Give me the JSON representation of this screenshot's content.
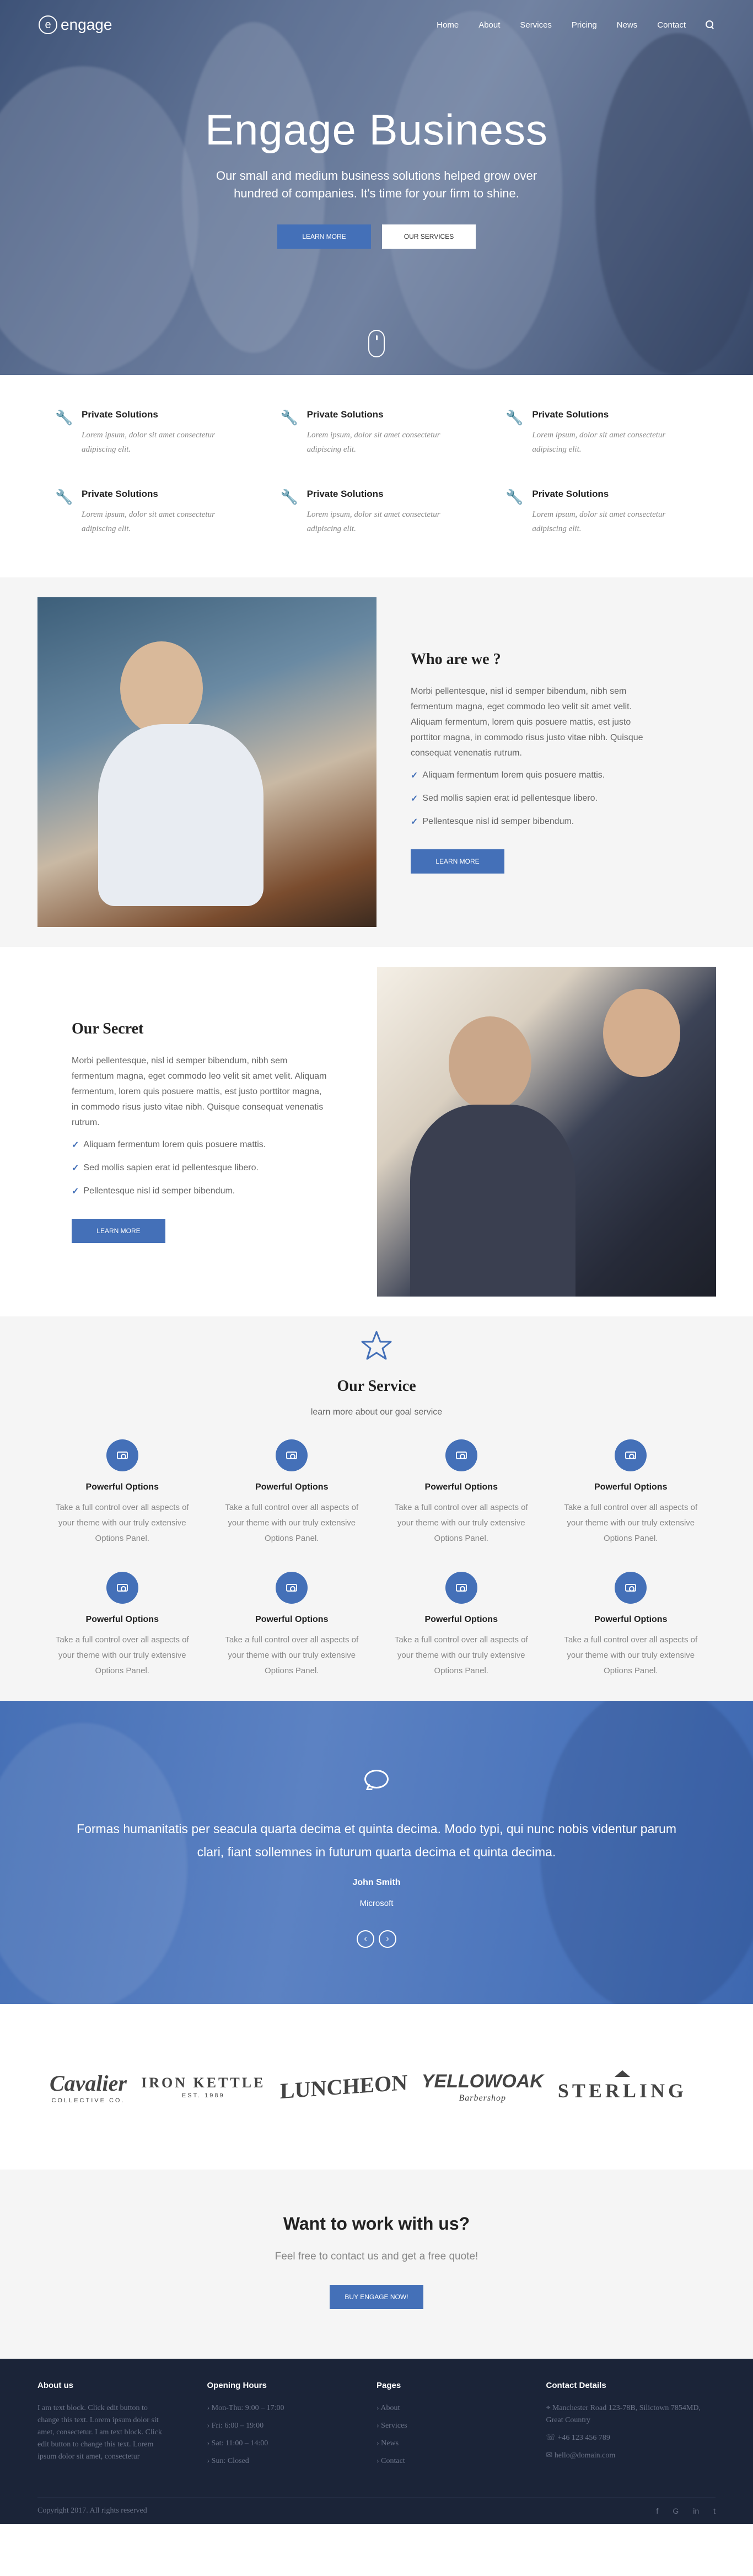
{
  "nav": {
    "logo": "engage",
    "items": [
      {
        "label": "Home",
        "icon": "caret-down-icon"
      },
      {
        "label": "About"
      },
      {
        "label": "Services",
        "icon": "caret-down-icon"
      },
      {
        "label": "Pricing"
      },
      {
        "label": "News"
      },
      {
        "label": "Contact"
      }
    ],
    "search_icon": "search-icon"
  },
  "hero": {
    "title": "Engage Business",
    "subtitle": "Our small and medium business solutions helped grow over hundred of companies. It's time for your firm to shine.",
    "btn_primary": "LEARN MORE",
    "btn_secondary": "OUR SERVICES"
  },
  "features": [
    {
      "icon": "wrench-icon",
      "title": "Private Solutions",
      "text": "Lorem ipsum, dolor sit amet consectetur adipiscing elit."
    },
    {
      "icon": "wrench-icon",
      "title": "Private Solutions",
      "text": "Lorem ipsum, dolor sit amet consectetur adipiscing elit."
    },
    {
      "icon": "wrench-icon",
      "title": "Private Solutions",
      "text": "Lorem ipsum, dolor sit amet consectetur adipiscing elit."
    },
    {
      "icon": "wrench-icon",
      "title": "Private Solutions",
      "text": "Lorem ipsum, dolor sit amet consectetur adipiscing elit."
    },
    {
      "icon": "wrench-icon",
      "title": "Private Solutions",
      "text": "Lorem ipsum, dolor sit amet consectetur adipiscing elit."
    },
    {
      "icon": "wrench-icon",
      "title": "Private Solutions",
      "text": "Lorem ipsum, dolor sit amet consectetur adipiscing elit."
    }
  ],
  "about": {
    "title": "Who are we ?",
    "text": "Morbi pellentesque, nisl id semper bibendum, nibh sem fermentum magna, eget commodo leo velit sit amet velit. Aliquam fermentum, lorem quis posuere mattis, est justo porttitor magna, in commodo risus justo vitae nibh. Quisque consequat venenatis rutrum.",
    "checks": [
      "Aliquam fermentum lorem quis posuere mattis.",
      "Sed mollis sapien erat id pellentesque libero.",
      "Pellentesque nisl id semper bibendum."
    ],
    "button": "LEARN MORE"
  },
  "secret": {
    "title": "Our Secret",
    "text": "Morbi pellentesque, nisl id semper bibendum, nibh sem fermentum magna, eget commodo leo velit sit amet velit. Aliquam fermentum, lorem quis posuere mattis, est justo porttitor magna, in commodo risus justo vitae nibh. Quisque consequat venenatis rutrum.",
    "checks": [
      "Aliquam fermentum lorem quis posuere mattis.",
      "Sed mollis sapien erat id pellentesque libero.",
      "Pellentesque nisl id semper bibendum."
    ],
    "button": "LEARN MORE"
  },
  "service": {
    "title": "Our Service",
    "subtitle": "learn more about our goal service",
    "items": [
      {
        "title": "Powerful Options",
        "text": "Take a full control over all aspects of your theme with our truly extensive Options Panel."
      },
      {
        "title": "Powerful Options",
        "text": "Take a full control over all aspects of your theme with our truly extensive Options Panel."
      },
      {
        "title": "Powerful Options",
        "text": "Take a full control over all aspects of your theme with our truly extensive Options Panel."
      },
      {
        "title": "Powerful Options",
        "text": "Take a full control over all aspects of your theme with our truly extensive Options Panel."
      },
      {
        "title": "Powerful Options",
        "text": "Take a full control over all aspects of your theme with our truly extensive Options Panel."
      },
      {
        "title": "Powerful Options",
        "text": "Take a full control over all aspects of your theme with our truly extensive Options Panel."
      },
      {
        "title": "Powerful Options",
        "text": "Take a full control over all aspects of your theme with our truly extensive Options Panel."
      },
      {
        "title": "Powerful Options",
        "text": "Take a full control over all aspects of your theme with our truly extensive Options Panel."
      }
    ]
  },
  "testimonial": {
    "quote": "Formas humanitatis per seacula quarta decima et quinta decima. Modo typi, qui nunc nobis videntur parum clari, fiant sollemnes in futurum quarta decima et quinta decima.",
    "author": "John Smith",
    "company": "Microsoft",
    "prev": "‹",
    "next": "›"
  },
  "logos": [
    {
      "name": "Cavalier",
      "sub": "COLLECTIVE CO."
    },
    {
      "name": "IRON KETTLE",
      "sub": "EST. 1989"
    },
    {
      "name": "LUNCHEON",
      "sub": ""
    },
    {
      "name": "YELLOWOAK",
      "sub": "Barbershop"
    },
    {
      "name": "STERLING",
      "sub": ""
    }
  ],
  "cta": {
    "title": "Want to work with us?",
    "text": "Feel free to contact us and get a free quote!",
    "button": "BUY ENGAGE NOW!"
  },
  "footer": {
    "about": {
      "title": "About us",
      "text": "I am text block. Click edit button to change this text. Lorem ipsum dolor sit amet, consectetur. I am text block. Click edit button to change this text. Lorem ipsum dolor sit amet, consectetur"
    },
    "hours": {
      "title": "Opening Hours",
      "items": [
        "Mon-Thu: 9:00 – 17:00",
        "Fri: 6:00 – 19:00",
        "Sat: 11:00 – 14:00",
        "Sun: Closed"
      ]
    },
    "pages": {
      "title": "Pages",
      "items": [
        "About",
        "Services",
        "News",
        "Contact"
      ]
    },
    "contact": {
      "title": "Contact Details",
      "address": "Manchester Road 123-78B, Silictown 7854MD, Great Country",
      "phone": "+46 123 456 789",
      "email": "hello@domain.com"
    },
    "copyright": "Copyright 2017. All rights reserved",
    "socials": [
      "f",
      "G",
      "in",
      "t"
    ]
  },
  "colors": {
    "accent": "#4470b8",
    "footer_bg": "#1b2438",
    "light_bg": "#f5f5f5"
  }
}
